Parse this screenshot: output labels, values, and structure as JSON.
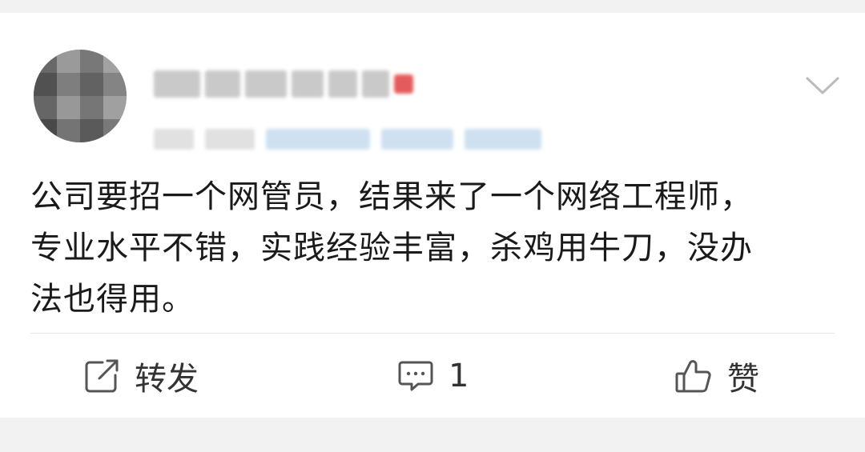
{
  "post": {
    "text": "公司要招一个网管员，结果来了一个网络工程师，专业水平不错，实践经验丰富，杀鸡用牛刀，没办法也得用。",
    "lines": [
      "公司要招一个网管员，结果来了一个网络工程师，",
      "专业水平不错，实践经验丰富，杀鸡用牛刀，没办",
      "法也得用。"
    ]
  },
  "actions": {
    "repost_label": "转发",
    "comment_count": "1",
    "like_label": "赞"
  },
  "icons": {
    "repost": "share-icon",
    "comment": "comment-icon",
    "like": "thumbs-up-icon",
    "menu": "chevron-down-icon"
  },
  "colors": {
    "background": "#f2f2f2",
    "card": "#ffffff",
    "text": "#1a1a1a",
    "action_text": "#333333",
    "icon": "#555555",
    "chevron": "#bbbbbb"
  }
}
